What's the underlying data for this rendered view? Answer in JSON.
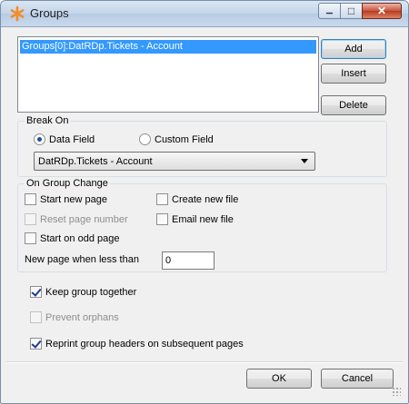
{
  "window": {
    "title": "Groups",
    "close_glyph": "✕",
    "min_glyph": "▁",
    "max_glyph": "□"
  },
  "groups_list": {
    "items": [
      "Groups[0]:DatRDp.Tickets - Account"
    ],
    "selected_index": 0
  },
  "buttons": {
    "add": "Add",
    "insert": "Insert",
    "delete": "Delete",
    "ok": "OK",
    "cancel": "Cancel"
  },
  "break_on": {
    "title": "Break On",
    "data_field_label": "Data Field",
    "custom_field_label": "Custom Field",
    "selected_option": "data_field",
    "field_value": "DatRDp.Tickets - Account"
  },
  "on_group_change": {
    "title": "On Group Change",
    "start_new_page": {
      "label": "Start new page",
      "checked": false,
      "enabled": true
    },
    "create_new_file": {
      "label": "Create new file",
      "checked": false,
      "enabled": true
    },
    "reset_page_number": {
      "label": "Reset page number",
      "checked": false,
      "enabled": false
    },
    "email_new_file": {
      "label": "Email new file",
      "checked": false,
      "enabled": true
    },
    "start_on_odd_page": {
      "label": "Start on odd page",
      "checked": false,
      "enabled": true
    },
    "new_page_when_less_than": {
      "label": "New page when less than",
      "value": "0"
    }
  },
  "options": {
    "keep_group_together": {
      "label": "Keep group together",
      "checked": true,
      "enabled": true
    },
    "prevent_orphans": {
      "label": "Prevent orphans",
      "checked": false,
      "enabled": false
    },
    "reprint_group_headers": {
      "label": "Reprint group headers on subsequent pages",
      "checked": true,
      "enabled": true
    }
  },
  "colors": {
    "selection": "#3399ff",
    "title_bar": "#c5d6ea",
    "close_button": "#c9533c",
    "app_icon": "#f28c28"
  },
  "icons": {
    "app": "asterisk-icon",
    "combo_arrow": "chevron-down-icon"
  }
}
